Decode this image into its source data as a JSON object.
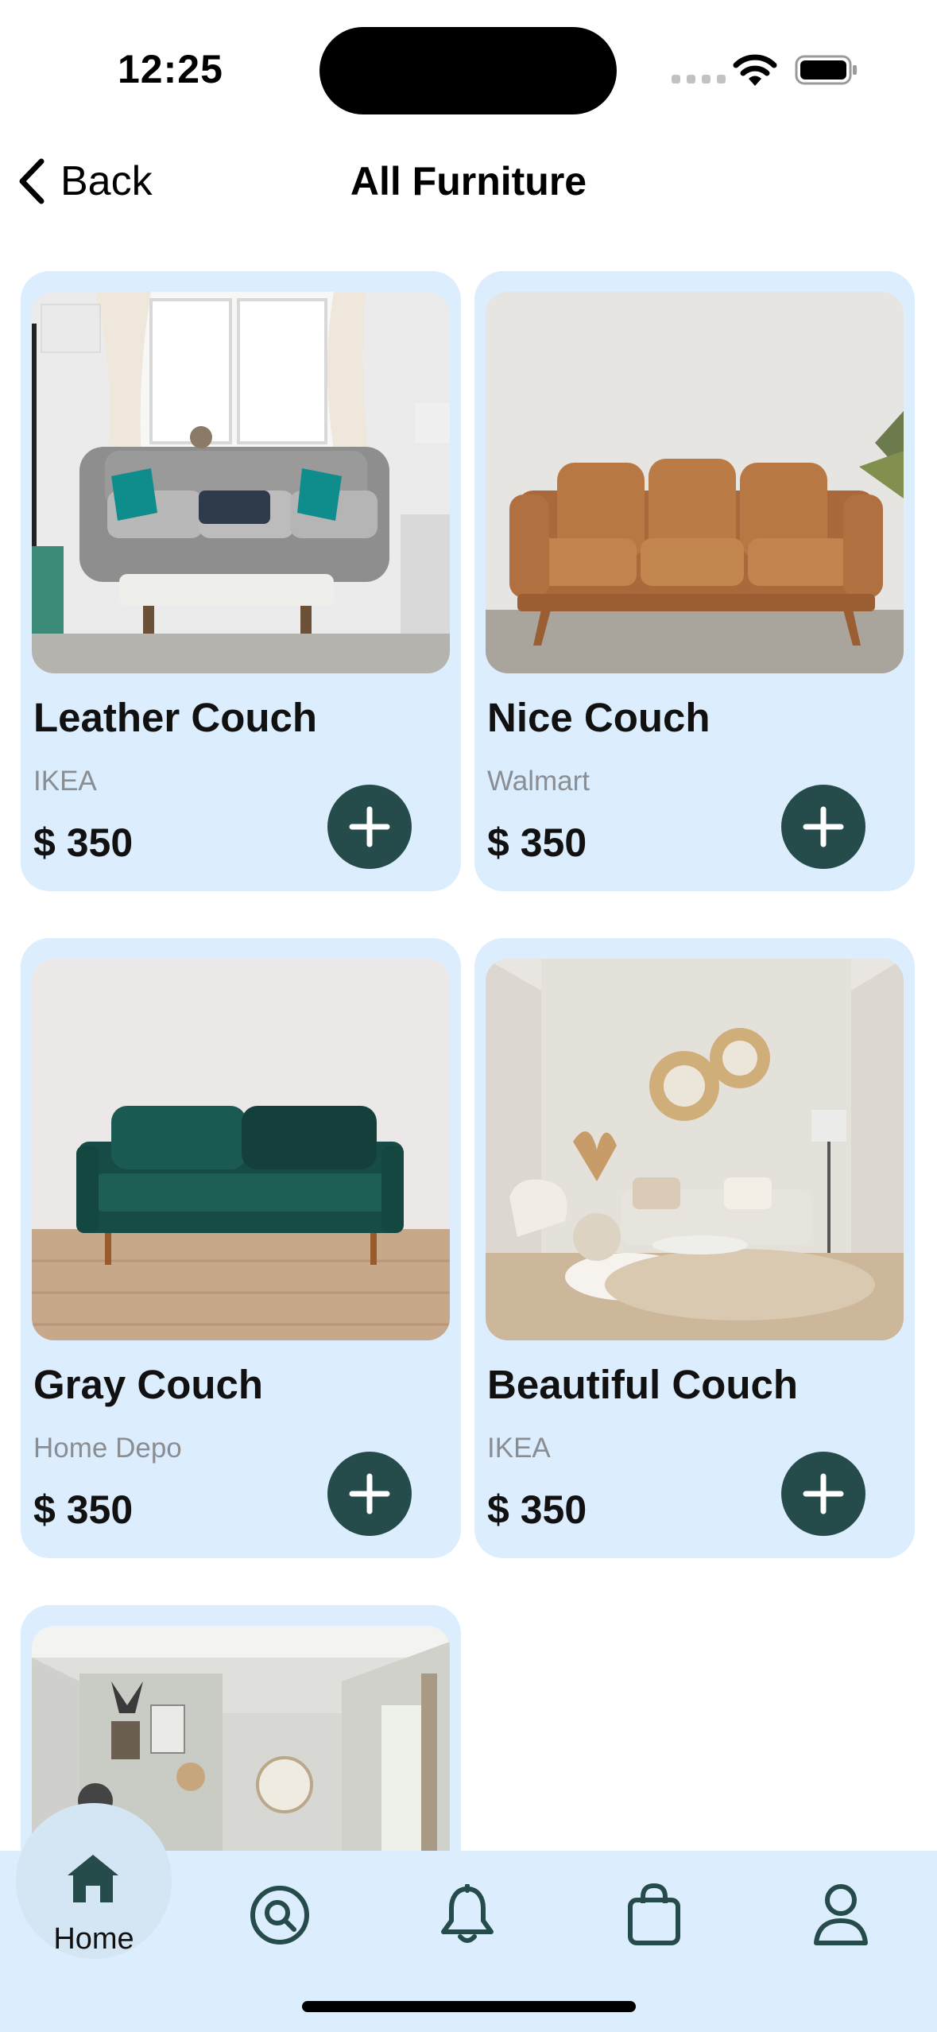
{
  "status_bar": {
    "time": "12:25"
  },
  "header": {
    "back_label": "Back",
    "title": "All Furniture"
  },
  "products": [
    {
      "name": "Leather Couch",
      "brand": "IKEA",
      "price": "$ 350"
    },
    {
      "name": "Nice Couch",
      "brand": "Walmart",
      "price": "$ 350"
    },
    {
      "name": "Gray Couch",
      "brand": "Home Depo",
      "price": "$ 350"
    },
    {
      "name": "Beautiful Couch",
      "brand": "IKEA",
      "price": "$ 350"
    }
  ],
  "tab_bar": {
    "active": "Home",
    "home_label": "Home",
    "icons": [
      "home-icon",
      "search-icon",
      "bell-icon",
      "bag-icon",
      "profile-icon"
    ]
  },
  "colors": {
    "card_bg": "#dcedfd",
    "accent": "#264b4b",
    "muted_text": "#8a8e93"
  }
}
